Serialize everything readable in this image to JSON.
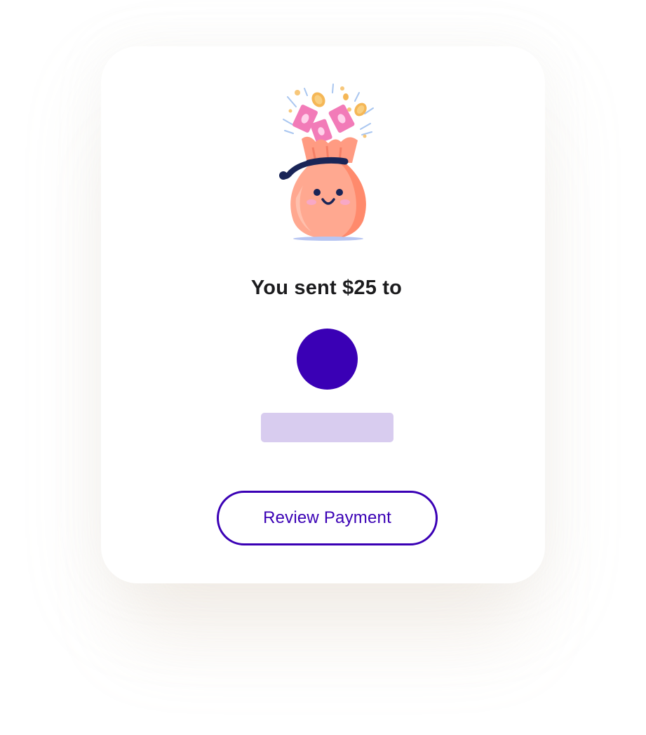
{
  "confirmation": {
    "headline": "You sent $25 to",
    "illustration_icon": "smiling-money-bag-icon",
    "recipient": {
      "avatar_color": "#3a00b5",
      "name_placeholder_color": "#d8ccef"
    },
    "review_button_label": "Review Payment"
  },
  "colors": {
    "accent": "#3a00b5",
    "text": "#1c1c1e",
    "card_background": "#ffffff"
  }
}
